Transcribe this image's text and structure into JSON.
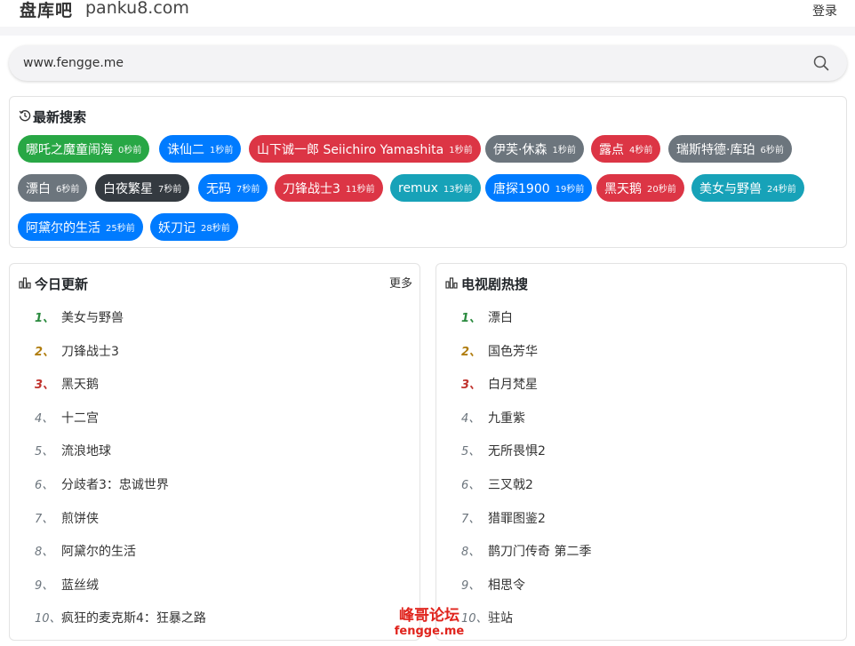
{
  "header": {
    "brand": "盘库吧",
    "domain": "panku8.com",
    "login": "登录"
  },
  "search": {
    "value": "www.fengge.me",
    "icon": "search-icon"
  },
  "recent": {
    "title": "最新搜索",
    "icon": "history-icon",
    "tags": [
      {
        "text": "哪吒之魔童闹海",
        "time": "0秒前",
        "color": "#28a745"
      },
      {
        "text": "诛仙二",
        "time": "1秒前",
        "color": "#007bff"
      },
      {
        "text": "山下诚一郎 Seiichiro Yamashita",
        "time": "1秒前",
        "color": "#dc3545"
      },
      {
        "text": "伊芙·休森",
        "time": "1秒前",
        "color": "#6c757d"
      },
      {
        "text": "露点",
        "time": "4秒前",
        "color": "#dc3545"
      },
      {
        "text": "瑞斯特德·库珀",
        "time": "6秒前",
        "color": "#6c757d"
      },
      {
        "text": "漂白",
        "time": "6秒前",
        "color": "#6c757d"
      },
      {
        "text": "白夜繁星",
        "time": "7秒前",
        "color": "#343a40"
      },
      {
        "text": "无码",
        "time": "7秒前",
        "color": "#007bff"
      },
      {
        "text": "刀锋战士3",
        "time": "11秒前",
        "color": "#dc3545"
      },
      {
        "text": "remux",
        "time": "13秒前",
        "color": "#17a2b8"
      },
      {
        "text": "唐探1900",
        "time": "19秒前",
        "color": "#007bff"
      },
      {
        "text": "黑天鹅",
        "time": "20秒前",
        "color": "#dc3545"
      },
      {
        "text": "美女与野兽",
        "time": "24秒前",
        "color": "#17a2b8"
      },
      {
        "text": "阿黛尔的生活",
        "time": "25秒前",
        "color": "#007bff"
      },
      {
        "text": "妖刀记",
        "time": "28秒前",
        "color": "#007bff"
      }
    ]
  },
  "today": {
    "title": "今日更新",
    "more": "更多",
    "icon": "chart-icon",
    "items": [
      {
        "num": "1、",
        "name": "美女与野兽"
      },
      {
        "num": "2、",
        "name": "刀锋战士3"
      },
      {
        "num": "3、",
        "name": "黑天鹅"
      },
      {
        "num": "4、",
        "name": "十二宫"
      },
      {
        "num": "5、",
        "name": "流浪地球"
      },
      {
        "num": "6、",
        "name": "分歧者3：忠诚世界"
      },
      {
        "num": "7、",
        "name": "煎饼侠"
      },
      {
        "num": "8、",
        "name": "阿黛尔的生活"
      },
      {
        "num": "9、",
        "name": "蓝丝绒"
      },
      {
        "num": "10、",
        "name": "疯狂的麦克斯4：狂暴之路"
      }
    ]
  },
  "tv": {
    "title": "电视剧热搜",
    "icon": "chart-icon",
    "items": [
      {
        "num": "1、",
        "name": "漂白"
      },
      {
        "num": "2、",
        "name": "国色芳华"
      },
      {
        "num": "3、",
        "name": "白月梵星"
      },
      {
        "num": "4、",
        "name": "九重紫"
      },
      {
        "num": "5、",
        "name": "无所畏惧2"
      },
      {
        "num": "6、",
        "name": "三叉戟2"
      },
      {
        "num": "7、",
        "name": "猎罪图鉴2"
      },
      {
        "num": "8、",
        "name": "鹊刀门传奇 第二季"
      },
      {
        "num": "9、",
        "name": "相思令"
      },
      {
        "num": "10、",
        "name": "驻站"
      }
    ]
  },
  "watermark": {
    "line1": "峰哥论坛",
    "line2": "fengge.me"
  }
}
